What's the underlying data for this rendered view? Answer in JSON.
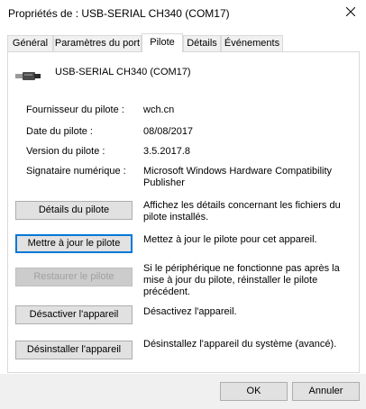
{
  "window": {
    "title": "Propriétés de : USB-SERIAL CH340 (COM17)"
  },
  "tabs": [
    {
      "label": "Général"
    },
    {
      "label": "Paramètres du port"
    },
    {
      "label": "Pilote"
    },
    {
      "label": "Détails"
    },
    {
      "label": "Événements"
    }
  ],
  "device": {
    "name": "USB-SERIAL CH340 (COM17)",
    "icon": "usb-plug-icon"
  },
  "driver_info": [
    {
      "label": "Fournisseur du pilote :",
      "value": "wch.cn"
    },
    {
      "label": "Date du pilote :",
      "value": "08/08/2017"
    },
    {
      "label": "Version du pilote :",
      "value": "3.5.2017.8"
    },
    {
      "label": "Signataire numérique :",
      "value": "Microsoft Windows Hardware Compatibility Publisher"
    }
  ],
  "actions": [
    {
      "button": "Détails du pilote",
      "description": "Affichez les détails concernant les fichiers du pilote installés."
    },
    {
      "button": "Mettre à jour le pilote",
      "description": "Mettez à jour le pilote pour cet appareil."
    },
    {
      "button": "Restaurer le pilote",
      "description": "Si le périphérique ne fonctionne pas après la mise à jour du pilote, réinstaller le pilote précédent."
    },
    {
      "button": "Désactiver l'appareil",
      "description": "Désactivez l'appareil."
    },
    {
      "button": "Désinstaller l'appareil",
      "description": "Désinstallez l'appareil du système (avancé)."
    }
  ],
  "footer": {
    "ok": "OK",
    "cancel": "Annuler"
  }
}
